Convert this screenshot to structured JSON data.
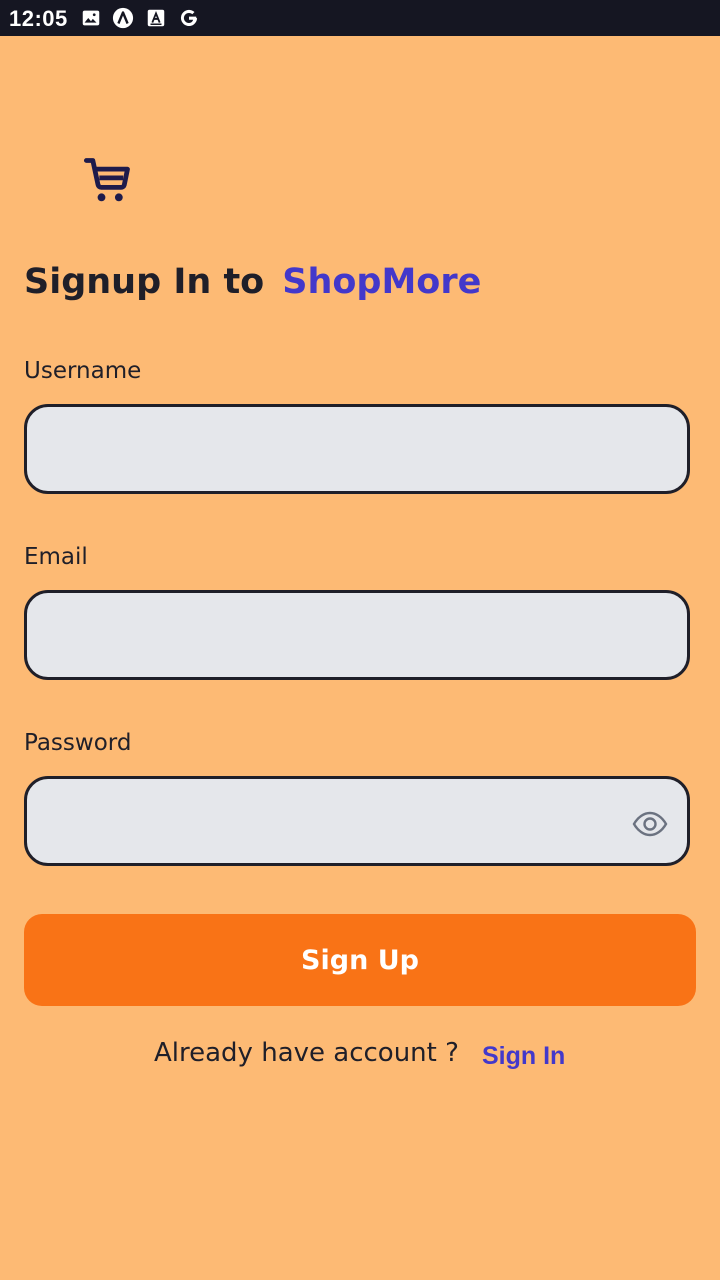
{
  "status_bar": {
    "time": "12:05",
    "icons": [
      "image-icon",
      "app-a-icon",
      "accessibility-icon",
      "google-icon"
    ]
  },
  "logo": {
    "icon": "shopping-cart-icon",
    "color": "#1e1b4b"
  },
  "header": {
    "title_prefix": "Signup In to",
    "brand_name": "ShopMore"
  },
  "form": {
    "username": {
      "label": "Username",
      "value": "",
      "placeholder": ""
    },
    "email": {
      "label": "Email",
      "value": "",
      "placeholder": ""
    },
    "password": {
      "label": "Password",
      "value": "",
      "placeholder": "",
      "toggle_icon": "eye-icon"
    },
    "submit_label": "Sign Up"
  },
  "footer": {
    "prompt": "Already have account ?",
    "link_label": "Sign In"
  },
  "colors": {
    "background": "#fdba74",
    "accent": "#f97316",
    "brand": "#4338ca",
    "input_bg": "#e5e7eb",
    "text": "#1f1f29"
  }
}
